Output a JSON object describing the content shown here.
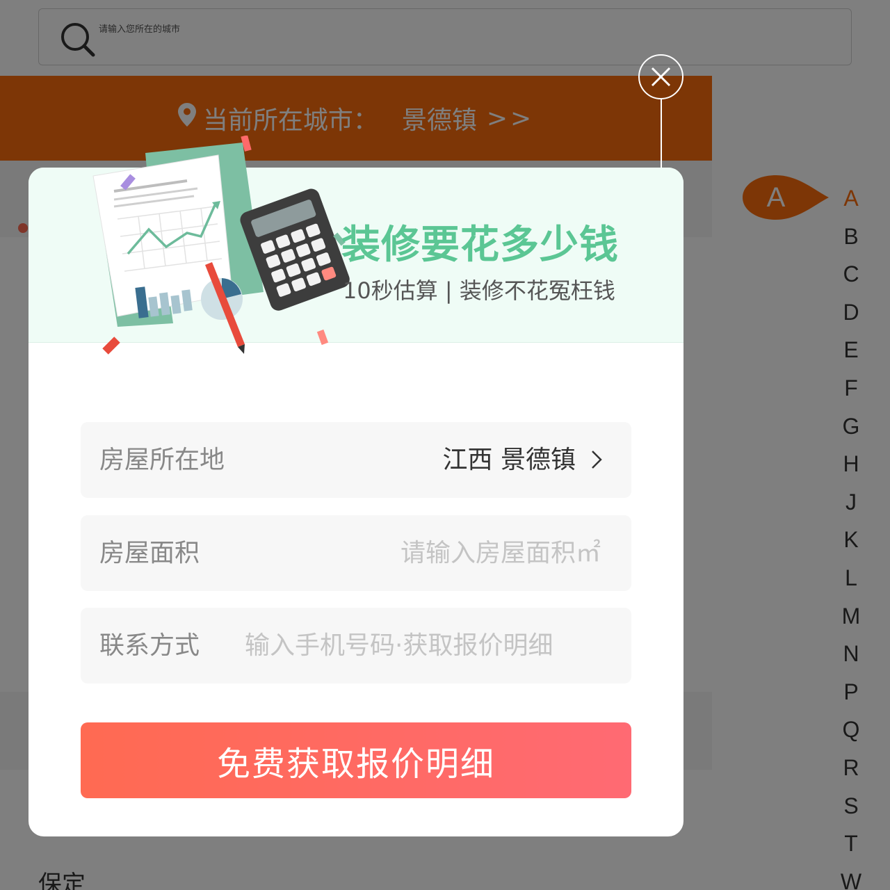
{
  "search": {
    "placeholder": "请输入您所在的城市"
  },
  "banner": {
    "label": "当前所在城市：",
    "city": "景德镇",
    "arrows": ">>"
  },
  "section_heading": "保定",
  "alpha_index": {
    "letters": [
      "A",
      "B",
      "C",
      "D",
      "E",
      "F",
      "G",
      "H",
      "J",
      "K",
      "L",
      "M",
      "N",
      "P",
      "Q",
      "R",
      "S",
      "T",
      "W"
    ],
    "active": "A",
    "bubble": "A"
  },
  "modal": {
    "title": "装修要花多少钱",
    "subtitle": "10秒估算 | 装修不花冤枉钱",
    "location": {
      "label": "房屋所在地",
      "value": "江西 景德镇"
    },
    "area": {
      "label": "房屋面积",
      "placeholder": "请输入房屋面积㎡"
    },
    "phone": {
      "label": "联系方式",
      "placeholder": "输入手机号码·获取报价明细"
    },
    "submit_label": "免费获取报价明细"
  },
  "colors": {
    "brand_orange": "#fb6d0d",
    "title_green": "#5bc694",
    "button_red": "#ff6a52",
    "overlay": "rgba(0,0,0,0.5)"
  },
  "icons": [
    "search-icon",
    "location-pin-icon",
    "close-icon",
    "chevron-right-icon",
    "calculator-illustration"
  ]
}
